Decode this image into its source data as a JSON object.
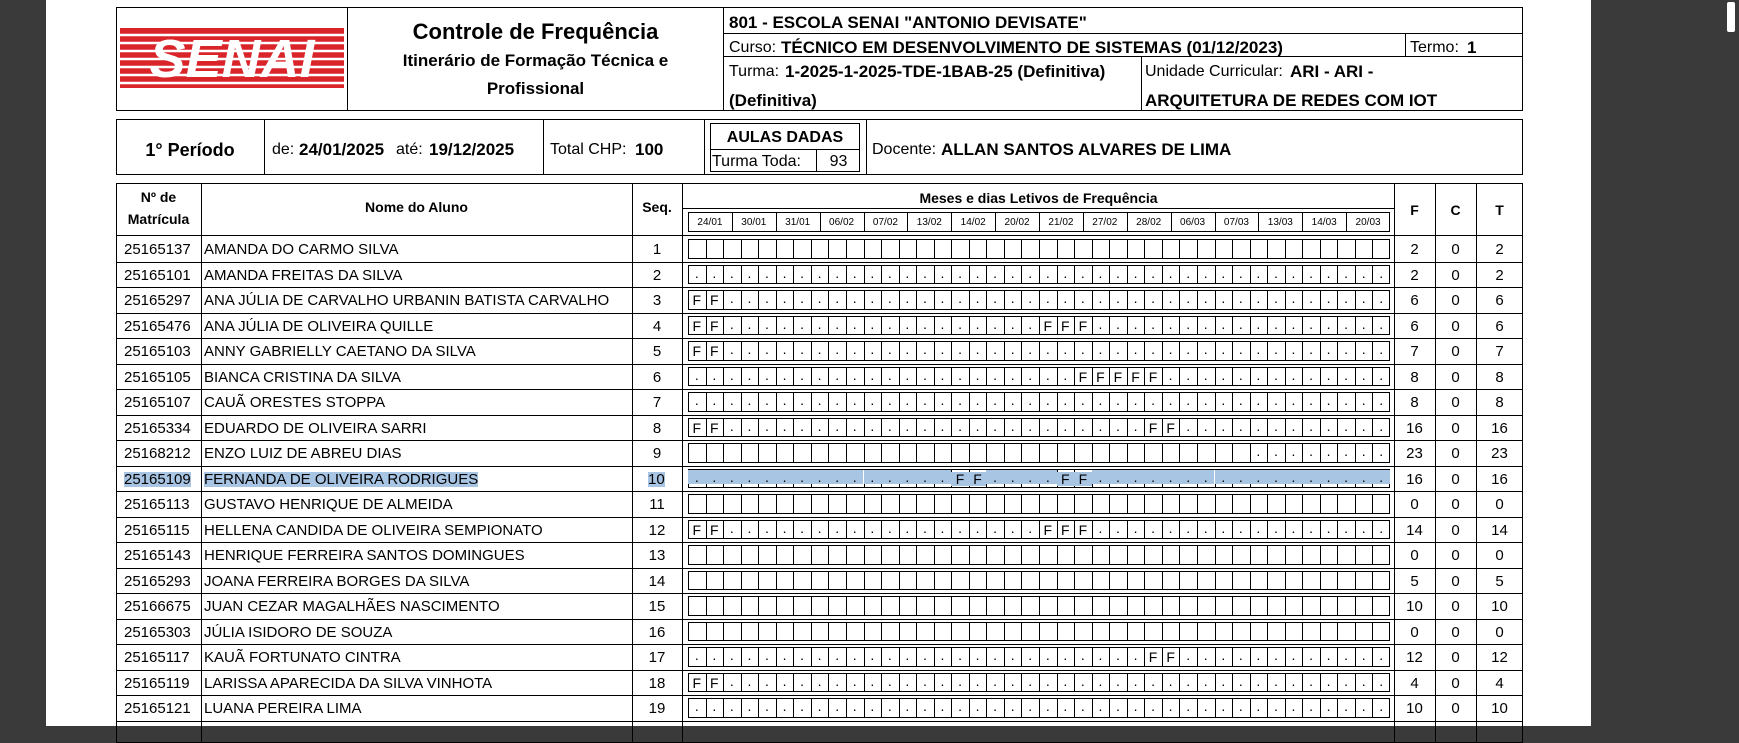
{
  "header": {
    "logo_text": "SENAI",
    "title": "Controle de Frequência",
    "subtitle_line1": "Itinerário de Formação Técnica e",
    "subtitle_line2": "Profissional",
    "school": "801 - ESCOLA SENAI \"ANTONIO DEVISATE\"",
    "curso_label": "Curso:",
    "curso_value": "TÉCNICO EM DESENVOLVIMENTO DE SISTEMAS (01/12/2023)",
    "termo_label": "Termo:",
    "termo_value": "1",
    "turma_label": "Turma:",
    "turma_value_line1": "1-2025-1-2025-TDE-1BAB-25 (Definitiva)",
    "turma_value_line2": "(Definitiva)",
    "uc_label": "Unidade Curricular:",
    "uc_value_line1": "ARI - ARI -",
    "uc_value_line2": "ARQUITETURA DE REDES COM IOT"
  },
  "period": {
    "periodo": "1° Período",
    "de_label": "de:",
    "de_value": "24/01/2025",
    "ate_label": "até:",
    "ate_value": "19/12/2025",
    "chp_label": "Total CHP:",
    "chp_value": "100",
    "aulas_dadas": "AULAS DADAS",
    "turma_toda_label": "Turma Toda:",
    "turma_toda_value": "93",
    "docente_label": "Docente:",
    "docente_value": "ALLAN SANTOS ALVARES DE LIMA"
  },
  "table": {
    "col_matricula_1": "Nº de",
    "col_matricula_2": "Matrícula",
    "col_nome": "Nome do Aluno",
    "col_seq": "Seq.",
    "col_meses": "Meses e dias Letivos de Frequência",
    "col_f": "F",
    "col_c": "C",
    "col_t": "T",
    "dates": [
      "24/01",
      "30/01",
      "31/01",
      "06/02",
      "07/02",
      "13/02",
      "14/02",
      "20/02",
      "21/02",
      "27/02",
      "28/02",
      "06/03",
      "07/03",
      "13/03",
      "14/03",
      "20/03"
    ],
    "rows": [
      {
        "mat": "25165137",
        "nome": "AMANDA DO CARMO SILVA",
        "seq": "1",
        "f": "2",
        "c": "0",
        "t": "2",
        "marks": "                                        "
      },
      {
        "mat": "25165101",
        "nome": "AMANDA FREITAS DA SILVA",
        "seq": "2",
        "f": "2",
        "c": "0",
        "t": "2",
        "marks": "........................................"
      },
      {
        "mat": "25165297",
        "nome": "ANA JÚLIA DE CARVALHO URBANIN BATISTA CARVALHO",
        "seq": "3",
        "f": "6",
        "c": "0",
        "t": "6",
        "marks": "FF......................................"
      },
      {
        "mat": "25165476",
        "nome": "ANA JÚLIA DE OLIVEIRA QUILLE",
        "seq": "4",
        "f": "6",
        "c": "0",
        "t": "6",
        "marks": "FF..................FFF................."
      },
      {
        "mat": "25165103",
        "nome": "ANNY GABRIELLY CAETANO DA SILVA",
        "seq": "5",
        "f": "7",
        "c": "0",
        "t": "7",
        "marks": "FF......................................"
      },
      {
        "mat": "25165105",
        "nome": "BIANCA CRISTINA DA SILVA",
        "seq": "6",
        "f": "8",
        "c": "0",
        "t": "8",
        "marks": "......................FFFFF............."
      },
      {
        "mat": "25165107",
        "nome": "CAUÃ ORESTES STOPPA",
        "seq": "7",
        "f": "8",
        "c": "0",
        "t": "8",
        "marks": "........................................"
      },
      {
        "mat": "25165334",
        "nome": "EDUARDO DE OLIVEIRA SARRI",
        "seq": "8",
        "f": "16",
        "c": "0",
        "t": "16",
        "marks": "FF........................FF............"
      },
      {
        "mat": "25168212",
        "nome": "ENZO LUIZ DE ABREU DIAS",
        "seq": "9",
        "f": "23",
        "c": "0",
        "t": "23",
        "marks": "                                .......:"
      },
      {
        "mat": "25165109",
        "nome": "FERNANDA DE OLIVEIRA RODRIGUES",
        "seq": "10",
        "f": "16",
        "c": "0",
        "t": "16",
        "marks": "...............FF....FF.....:..........."
      },
      {
        "mat": "25165113",
        "nome": "GUSTAVO HENRIQUE DE ALMEIDA",
        "seq": "11",
        "f": "0",
        "c": "0",
        "t": "0",
        "marks": "                                        "
      },
      {
        "mat": "25165115",
        "nome": "HELLENA CANDIDA DE OLIVEIRA SEMPIONATO",
        "seq": "12",
        "f": "14",
        "c": "0",
        "t": "14",
        "marks": "FF..................FFF................."
      },
      {
        "mat": "25165143",
        "nome": "HENRIQUE FERREIRA SANTOS DOMINGUES",
        "seq": "13",
        "f": "0",
        "c": "0",
        "t": "0",
        "marks": "                                        "
      },
      {
        "mat": "25165293",
        "nome": "JOANA FERREIRA BORGES DA SILVA",
        "seq": "14",
        "f": "5",
        "c": "0",
        "t": "5",
        "marks": "                                        "
      },
      {
        "mat": "25166675",
        "nome": "JUAN CEZAR MAGALHÃES NASCIMENTO",
        "seq": "15",
        "f": "10",
        "c": "0",
        "t": "10",
        "marks": "                                        "
      },
      {
        "mat": "25165303",
        "nome": "JÚLIA ISIDORO DE SOUZA",
        "seq": "16",
        "f": "0",
        "c": "0",
        "t": "0",
        "marks": "                                        "
      },
      {
        "mat": "25165117",
        "nome": "KAUÃ FORTUNATO CINTRA",
        "seq": "17",
        "f": "12",
        "c": "0",
        "t": "12",
        "marks": "..........................FF............"
      },
      {
        "mat": "25165119",
        "nome": "LARISSA APARECIDA DA SILVA VINHOTA",
        "seq": "18",
        "f": "4",
        "c": "0",
        "t": "4",
        "marks": "FF......................................"
      },
      {
        "mat": "25165121",
        "nome": "LUANA PEREIRA LIMA",
        "seq": "19",
        "f": "10",
        "c": "0",
        "t": "10",
        "marks": "........................................"
      }
    ]
  },
  "colors": {
    "logo_red": "#d9252a",
    "highlight": "#a9c5e4",
    "background": "#3a3a3a"
  }
}
